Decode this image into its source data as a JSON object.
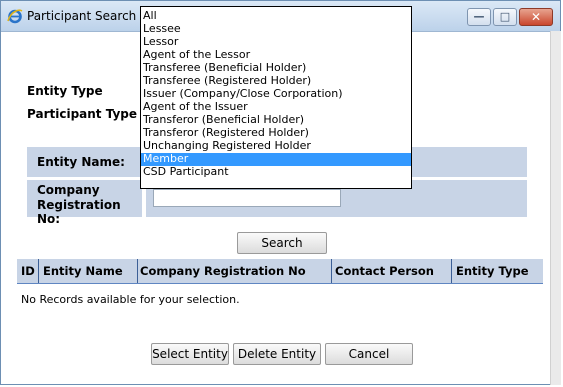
{
  "window": {
    "title": "Participant Search - Inte"
  },
  "form": {
    "entity_type_label": "Entity Type",
    "participant_type_label": "Participant Type",
    "entity_name_label": "Entity Name:",
    "company_reg_label_line1": "Company",
    "company_reg_label_line2": "Registration No:",
    "entity_name_value": "",
    "company_reg_value": ""
  },
  "buttons": {
    "search": "Search",
    "select_entity": "Select Entity",
    "delete_entity": "Delete Entity",
    "cancel": "Cancel"
  },
  "table": {
    "columns": [
      "ID",
      "Entity Name",
      "Company Registration No",
      "Contact Person",
      "Entity Type"
    ],
    "empty_message": "No Records available for your selection."
  },
  "dropdown": {
    "selected": "Member",
    "options": [
      "All",
      "Lessee",
      "Lessor",
      "Agent of the Lessor",
      "Transferee (Beneficial Holder)",
      "Transferee (Registered Holder)",
      "Issuer (Company/Close Corporation)",
      "Agent of the Issuer",
      "Transferor (Beneficial Holder)",
      "Transferor (Registered Holder)",
      "Unchanging Registered Holder",
      "Member",
      "CSD Participant"
    ]
  },
  "icons": {
    "app": "internet-explorer-icon",
    "minimize": "minimize-icon",
    "maximize": "maximize-icon",
    "close": "close-icon"
  },
  "colors": {
    "selection": "#3399ff",
    "header_bg": "#c8d4e6",
    "close_button": "#c9462c"
  }
}
